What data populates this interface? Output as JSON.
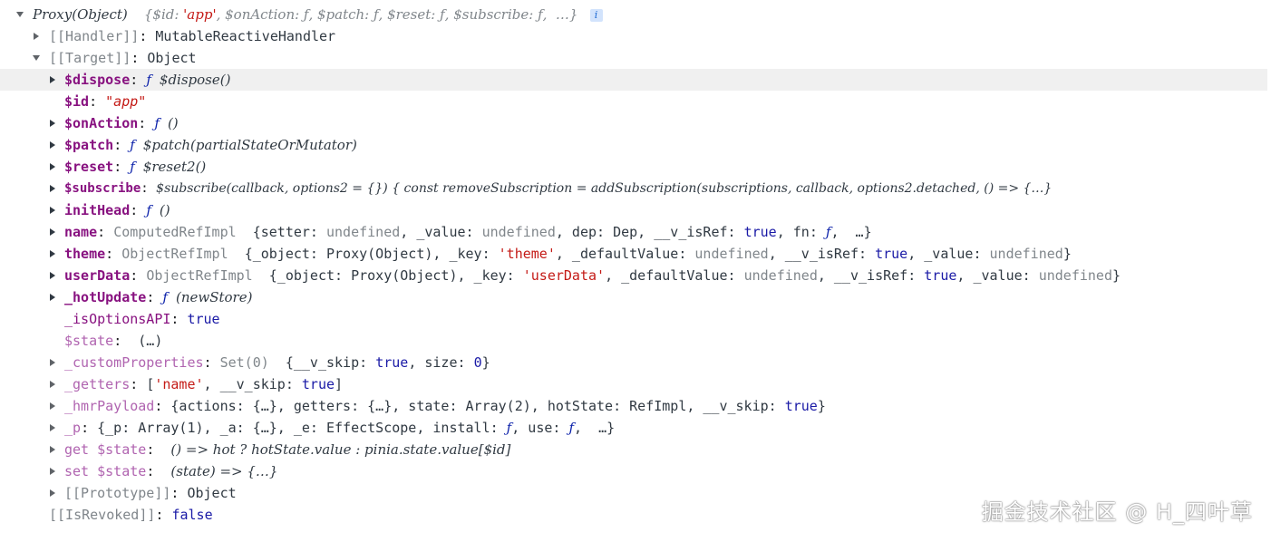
{
  "root": {
    "title": "Proxy(Object)",
    "preview": "{$id: 'app', $onAction: ƒ, $patch: ƒ, $reset: ƒ, $subscribe: ƒ,  …}",
    "info_badge": "i"
  },
  "handler": {
    "key": "[[Handler]]",
    "value": "MutableReactiveHandler"
  },
  "target": {
    "key": "[[Target]]",
    "value": "Object"
  },
  "rows": [
    {
      "key": "$dispose",
      "f": "ƒ",
      "value": "$dispose()"
    },
    {
      "key": "$id",
      "value": "\"app\""
    },
    {
      "key": "$onAction",
      "f": "ƒ",
      "value": "()"
    },
    {
      "key": "$patch",
      "f": "ƒ",
      "value": "$patch(partialStateOrMutator)"
    },
    {
      "key": "$reset",
      "f": "ƒ",
      "value": "$reset2()"
    },
    {
      "key": "$subscribe",
      "value": "$subscribe(callback, options2 = {}) { const removeSubscription = addSubscription(subscriptions, callback, options2.detached, () => {…}"
    },
    {
      "key": "initHead",
      "f": "ƒ",
      "value": "()"
    },
    {
      "key": "name",
      "cls": "ComputedRefImpl",
      "value": "{setter: undefined, _value: undefined, dep: Dep, __v_isRef: true, fn: ƒ,  …}"
    },
    {
      "key": "theme",
      "cls": "ObjectRefImpl",
      "value": "{_object: Proxy(Object), _key: 'theme', _defaultValue: undefined, __v_isRef: true, _value: undefined}"
    },
    {
      "key": "userData",
      "cls": "ObjectRefImpl",
      "value": "{_object: Proxy(Object), _key: 'userData', _defaultValue: undefined, __v_isRef: true, _value: undefined}"
    },
    {
      "key": "_hotUpdate",
      "f": "ƒ",
      "value": "(newStore)"
    },
    {
      "key": "_isOptionsAPI",
      "value": "true"
    },
    {
      "key": "$state",
      "value": "(…)"
    },
    {
      "key": "_customProperties",
      "value": "Set(0)  {__v_skip: true, size: 0}"
    },
    {
      "key": "_getters",
      "value": "['name', __v_skip: true]"
    },
    {
      "key": "_hmrPayload",
      "value": "{actions: {…}, getters: {…}, state: Array(2), hotState: RefImpl, __v_skip: true}"
    },
    {
      "key": "_p",
      "value": "{_p: Array(1), _a: {…}, _e: EffectScope, install: ƒ, use: ƒ,  …}"
    },
    {
      "key": "get $state",
      "value": "() => hot ? hotState.value : pinia.state.value[$id]"
    },
    {
      "key": "set $state",
      "value": "(state) => {…}"
    },
    {
      "key": "[[Prototype]]",
      "value": "Object"
    },
    {
      "key": "[[IsRevoked]]",
      "value": "false"
    }
  ],
  "watermark": "掘金技术社区 @ H_四叶草"
}
